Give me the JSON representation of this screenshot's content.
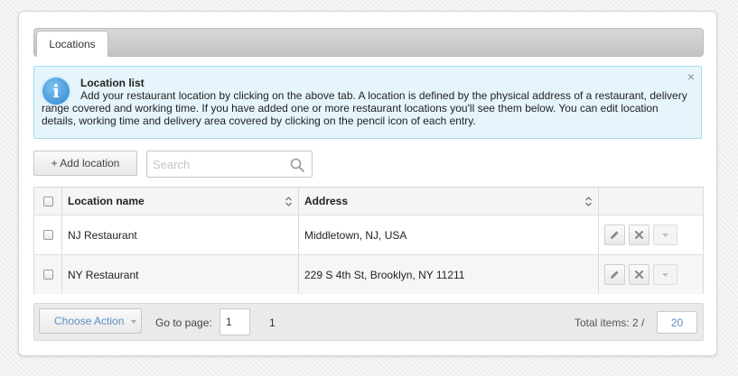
{
  "tabs": [
    {
      "label": "Locations"
    }
  ],
  "info": {
    "title": "Location list",
    "text": "Add your restaurant location by clicking on the above tab. A location is defined by the physical address of a restaurant, delivery range covered and working time. If you have added one or more restaurant locations you'll see them below. You can edit location details, working time and delivery area covered by clicking on the pencil icon of each entry.",
    "close_icon": "×"
  },
  "toolbar": {
    "add_label": "+ Add location",
    "search_placeholder": "Search"
  },
  "table": {
    "columns": [
      "Location name",
      "Address"
    ],
    "rows": [
      {
        "name": "NJ Restaurant",
        "address": "Middletown, NJ, USA"
      },
      {
        "name": "NY Restaurant",
        "address": "229 S 4th St, Brooklyn, NY 11211"
      }
    ]
  },
  "footer": {
    "choose_action": "Choose Action",
    "goto_label": "Go to page:",
    "page_value": "1",
    "page_count": "1",
    "total_label": "Total items: 2 /",
    "per_page": "20"
  },
  "colors": {
    "info_bg": "#e6f5fb",
    "info_border": "#a9daf0",
    "link_blue": "#5a8fbf"
  }
}
